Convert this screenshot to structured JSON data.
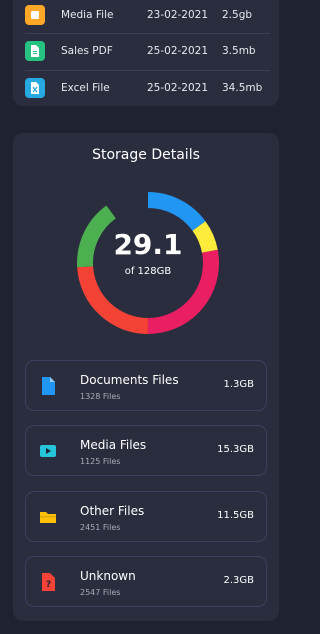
{
  "recent_files": [
    {
      "name": "Media File",
      "date": "23-02-2021",
      "size": "2.5gb",
      "icon": "media-file-icon",
      "color": "#ffa726"
    },
    {
      "name": "Sales PDF",
      "date": "25-02-2021",
      "size": "3.5mb",
      "icon": "pdf-file-icon",
      "color": "#26c281"
    },
    {
      "name": "Excel File",
      "date": "25-02-2021",
      "size": "34.5mb",
      "icon": "excel-file-icon",
      "color": "#26a9e0"
    }
  ],
  "storage": {
    "title": "Storage Details",
    "used": "29.1",
    "total_label": "of 128GB",
    "ring_segments": [
      {
        "color": "#2196f3",
        "share": 0.15
      },
      {
        "color": "#ffeb3b",
        "share": 0.07
      },
      {
        "color": "#e91e63",
        "share": 0.28
      },
      {
        "color": "#f44336",
        "share": 0.24
      },
      {
        "color": "#4caf50",
        "share": 0.16
      }
    ],
    "items": [
      {
        "label": "Documents Files",
        "count": "1328 Files",
        "amount": "1.3GB",
        "icon": "document-icon",
        "color": "#2196f3"
      },
      {
        "label": "Media Files",
        "count": "1125 Files",
        "amount": "15.3GB",
        "icon": "media-play-icon",
        "color": "#26c6da"
      },
      {
        "label": "Other Files",
        "count": "2451 Files",
        "amount": "11.5GB",
        "icon": "folder-icon",
        "color": "#ffc107"
      },
      {
        "label": "Unknown",
        "count": "2547 Files",
        "amount": "2.3GB",
        "icon": "unknown-file-icon",
        "color": "#f44336"
      }
    ]
  }
}
